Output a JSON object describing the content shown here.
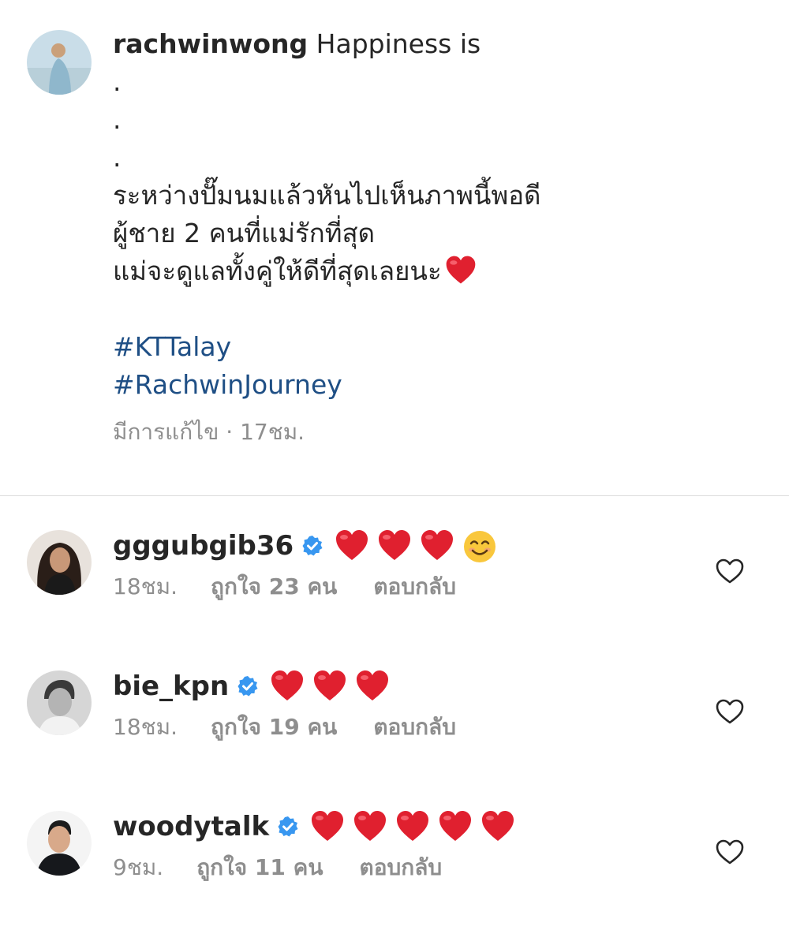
{
  "caption": {
    "username": "rachwinwong",
    "first_line": "Happiness is",
    "dots": [
      ".",
      ".",
      "."
    ],
    "lines": [
      "ระหว่างปั๊มนมแล้วหันไปเห็นภาพนี้พอดี",
      "ผู้ชาย 2 คนที่แม่รักที่สุด",
      "แม่จะดูแลทั้งคู่ให้ดีที่สุดเลยนะ"
    ],
    "hashtags": [
      "#KTTalay",
      "#RachwinJourney"
    ],
    "meta": "มีการแก้ไข · 17ชม."
  },
  "comments": [
    {
      "username": "gggubgib36",
      "emojis": [
        "red-heart-emoji",
        "red-heart-emoji",
        "red-heart-emoji",
        "smiling-face-emoji"
      ],
      "time": "18ชม.",
      "likes": "ถูกใจ 23 คน",
      "reply": "ตอบกลับ"
    },
    {
      "username": "bie_kpn",
      "emojis": [
        "red-heart-emoji",
        "red-heart-emoji",
        "red-heart-emoji"
      ],
      "time": "18ชม.",
      "likes": "ถูกใจ 19 คน",
      "reply": "ตอบกลับ"
    },
    {
      "username": "woodytalk",
      "emojis": [
        "red-heart-emoji",
        "red-heart-emoji",
        "red-heart-emoji",
        "red-heart-emoji",
        "red-heart-emoji"
      ],
      "time": "9ชม.",
      "likes": "ถูกใจ 11 คน",
      "reply": "ตอบกลับ"
    }
  ],
  "icons": {
    "verified": "verified-badge-icon",
    "like": "heart-outline-icon"
  },
  "colors": {
    "text": "#262626",
    "secondary": "#8e8e8e",
    "hashtag": "#1f4f85",
    "verified": "#3897f0",
    "heart_emoji": "#e0202f",
    "divider": "#dbdbdb"
  }
}
